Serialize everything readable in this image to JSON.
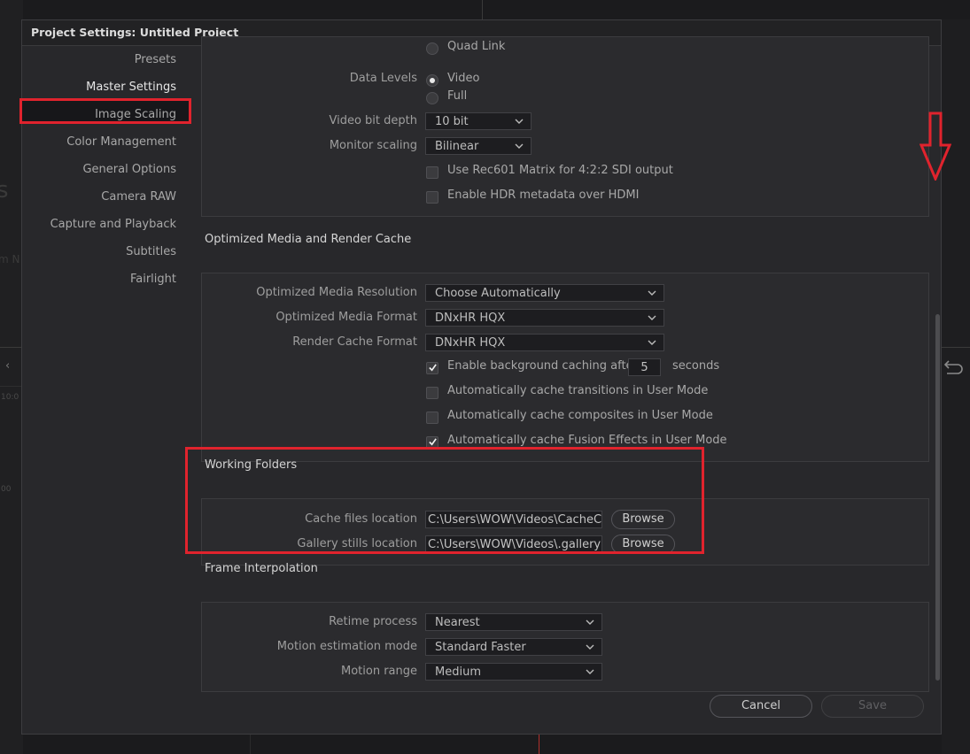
{
  "dialog": {
    "title": "Project Settings:  Untitled Project"
  },
  "sidebar": {
    "items": [
      "Presets",
      "Master Settings",
      "Image Scaling",
      "Color Management",
      "General Options",
      "Camera RAW",
      "Capture and Playback",
      "Subtitles",
      "Fairlight"
    ],
    "active": "Master Settings"
  },
  "video_monitoring": {
    "quad_link_label": "Quad Link",
    "data_levels_label": "Data Levels",
    "data_levels_options": [
      "Video",
      "Full"
    ],
    "data_levels_selected": "Video",
    "bit_depth_label": "Video bit depth",
    "bit_depth_value": "10 bit",
    "monitor_scaling_label": "Monitor scaling",
    "monitor_scaling_value": "Bilinear",
    "rec601_label": "Use Rec601 Matrix for 4:2:2 SDI output",
    "rec601_checked": false,
    "hdr_label": "Enable HDR metadata over HDMI",
    "hdr_checked": false
  },
  "optimized_media": {
    "title": "Optimized Media and Render Cache",
    "resolution_label": "Optimized Media Resolution",
    "resolution_value": "Choose Automatically",
    "format_label": "Optimized Media Format",
    "format_value": "DNxHR HQX",
    "render_cache_label": "Render Cache Format",
    "render_cache_value": "DNxHR HQX",
    "bg_caching_label": "Enable background caching after",
    "bg_caching_checked": true,
    "bg_caching_seconds": "5",
    "seconds_label": "seconds",
    "cache_transitions_label": "Automatically cache transitions in User Mode",
    "cache_transitions_checked": false,
    "cache_composites_label": "Automatically cache composites in User Mode",
    "cache_composites_checked": false,
    "cache_fusion_label": "Automatically cache Fusion Effects in User Mode",
    "cache_fusion_checked": true
  },
  "working_folders": {
    "title": "Working Folders",
    "cache_label": "Cache files location",
    "cache_value": "C:\\Users\\WOW\\Videos\\CacheClip",
    "gallery_label": "Gallery stills location",
    "gallery_value": "C:\\Users\\WOW\\Videos\\.gallery",
    "browse_label": "Browse"
  },
  "frame_interpolation": {
    "title": "Frame Interpolation",
    "retime_label": "Retime process",
    "retime_value": "Nearest",
    "motion_est_label": "Motion estimation mode",
    "motion_est_value": "Standard Faster",
    "motion_range_label": "Motion range",
    "motion_range_value": "Medium"
  },
  "footer": {
    "cancel_label": "Cancel",
    "save_label": "Save"
  },
  "background": {
    "ghost_large": "s",
    "ghost_small": "m N",
    "ghost_tc1": ":10:0",
    "ghost_tc2": ":00"
  },
  "colors": {
    "accent_red": "#e0232d",
    "panel": "#2b2b2e",
    "dialog": "#28282b"
  }
}
